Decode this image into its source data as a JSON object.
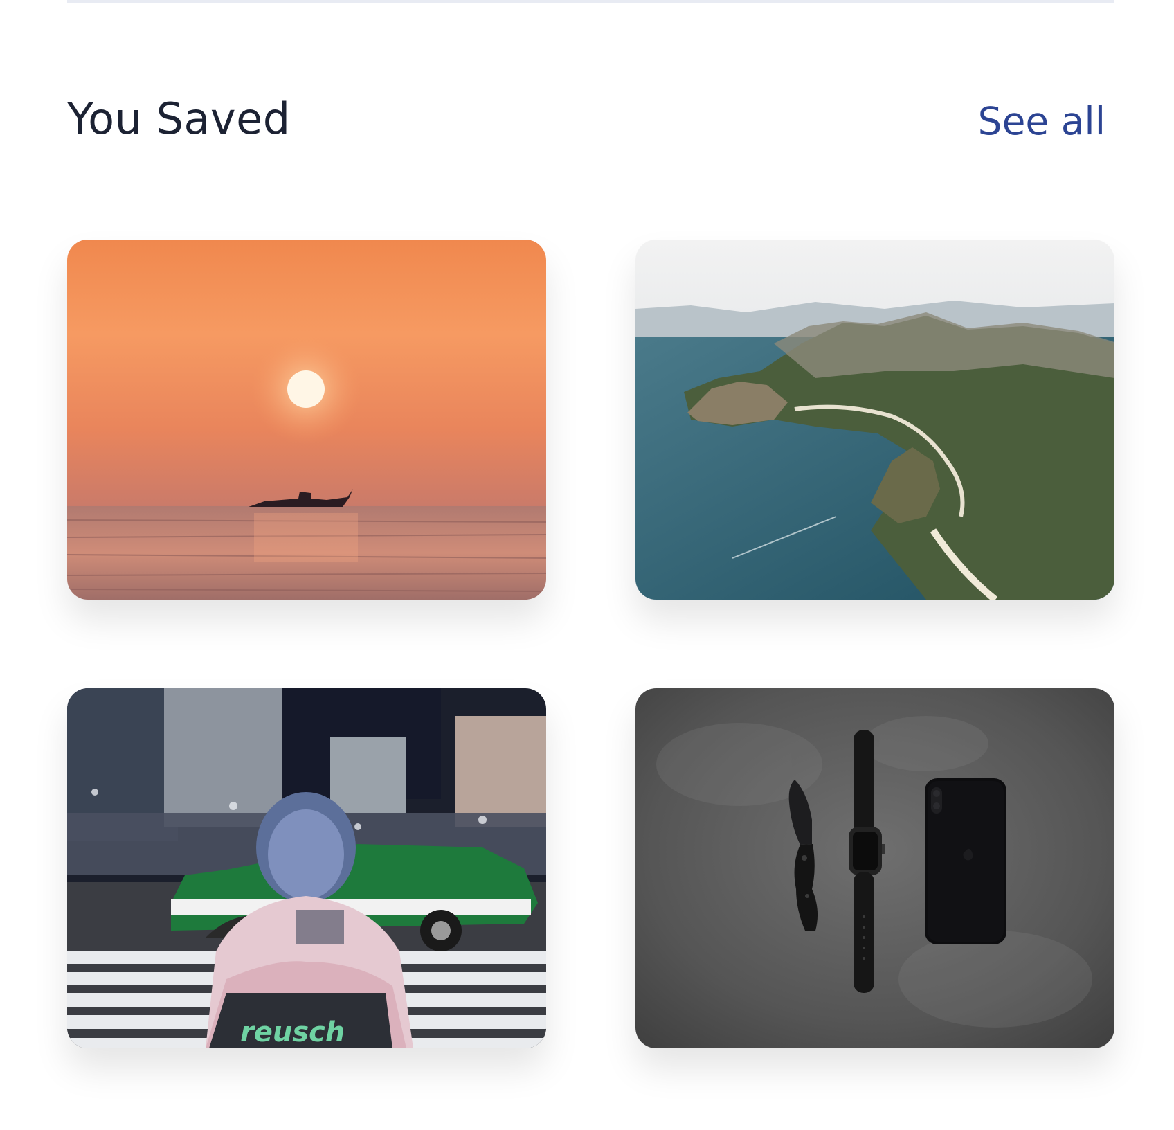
{
  "section": {
    "title": "You Saved",
    "see_all_label": "See all"
  },
  "saved_items": [
    {
      "subject": "sunset-boat-photo"
    },
    {
      "subject": "island-aerial-photo"
    },
    {
      "subject": "city-night-crosswalk-photo"
    },
    {
      "subject": "knife-watch-phone-flatlay-photo"
    }
  ],
  "colors": {
    "title": "#1c2233",
    "link": "#2c4493",
    "divider": "#e8ebf3"
  }
}
